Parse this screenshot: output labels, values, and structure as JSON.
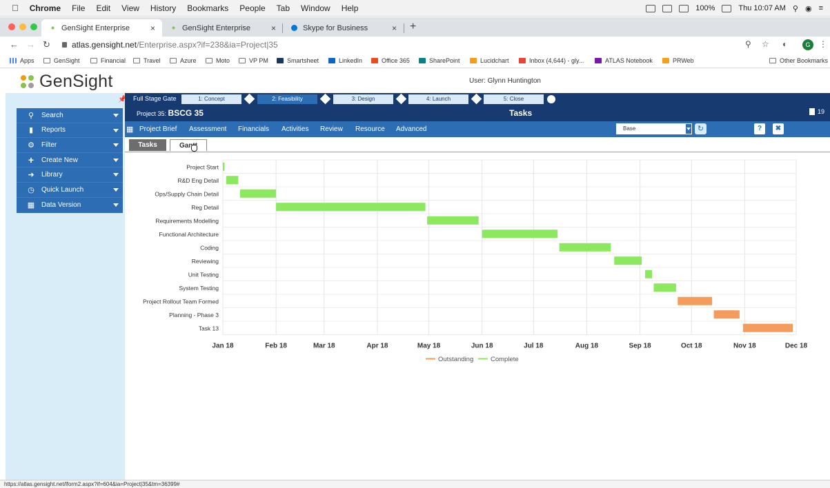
{
  "macos_menu": {
    "apple": "",
    "items": [
      "Chrome",
      "File",
      "Edit",
      "View",
      "History",
      "Bookmarks",
      "People",
      "Tab",
      "Window",
      "Help"
    ],
    "battery": "100%",
    "clock": "Thu 10:07 AM"
  },
  "browser": {
    "tabs": [
      {
        "title": "GenSight Enterprise",
        "active": true
      },
      {
        "title": "GenSight Enterprise",
        "active": false
      },
      {
        "title": "Skype for Business",
        "active": false
      }
    ],
    "new_tab": "+",
    "url_host": "atlas.gensight.net",
    "url_path": "/Enterprise.aspx?if=238&ia=Project|35",
    "profile_initial": "G",
    "bookmarks": [
      "Apps",
      "GenSight",
      "Financial",
      "Travel",
      "Azure",
      "Moto",
      "VP PM",
      "Smartsheet",
      "LinkedIn",
      "Office 365",
      "SharePoint",
      "Lucidchart",
      "Inbox (4,644) - gly...",
      "ATLAS Notebook",
      "PRWeb",
      "Other Bookmarks"
    ]
  },
  "app": {
    "logo_text": "GenSight",
    "user_label": "User: Glynn Huntington",
    "colors": {
      "sidebar_bg": "#d9edf9",
      "menu_bg": "#2d6db3",
      "stagebar_bg": "#173a70",
      "navbar_bg": "#2d6db3",
      "complete": "#8ce85e",
      "outstanding": "#f39c5b"
    }
  },
  "sidebar": {
    "items": [
      {
        "label": "Search",
        "icon": "search-icon"
      },
      {
        "label": "Reports",
        "icon": "document-icon"
      },
      {
        "label": "Filter",
        "icon": "gear-icon"
      },
      {
        "label": "Create New",
        "icon": "plus-icon"
      },
      {
        "label": "Library",
        "icon": "arrow-right-icon"
      },
      {
        "label": "Quick Launch",
        "icon": "clock-icon"
      },
      {
        "label": "Data Version",
        "icon": "calendar-icon"
      }
    ]
  },
  "stage_gate": {
    "title": "Full Stage Gate",
    "stages": [
      "1: Concept",
      "2: Feasibility",
      "3: Design",
      "4: Launch",
      "5: Close"
    ],
    "active_stage": 1,
    "project_prefix": "Project 35:",
    "project_name": "BSCG 35",
    "page_title": "Tasks",
    "doc_count": "19"
  },
  "nav": {
    "items": [
      "Project Brief",
      "Assessment",
      "Financials",
      "Activities",
      "Review",
      "Resource",
      "Advanced"
    ],
    "baseline_select": "Base",
    "help": "?"
  },
  "subtabs": {
    "tasks": "Tasks",
    "gantt": "Gantt"
  },
  "chart_data": {
    "type": "gantt",
    "x_ticks": [
      "Jan 18",
      "Feb 18",
      "Mar 18",
      "Apr 18",
      "May 18",
      "Jun 18",
      "Jul 18",
      "Aug 18",
      "Sep 18",
      "Oct 18",
      "Nov 18",
      "Dec 18"
    ],
    "xlim": [
      "2018-01-01",
      "2018-12-01"
    ],
    "grid": true,
    "legend": [
      "Outstanding",
      "Complete"
    ],
    "legend_position": "bottom",
    "tasks": [
      {
        "name": "Project Start",
        "start": "2018-01-01",
        "end": "2018-01-02",
        "status": "Complete"
      },
      {
        "name": "R&D Eng Detail",
        "start": "2018-01-03",
        "end": "2018-01-10",
        "status": "Complete"
      },
      {
        "name": "Ops/Supply Chain Detail",
        "start": "2018-01-11",
        "end": "2018-02-01",
        "status": "Complete"
      },
      {
        "name": "Reg Detail",
        "start": "2018-02-01",
        "end": "2018-04-29",
        "status": "Complete"
      },
      {
        "name": "Requirements Modelling",
        "start": "2018-04-30",
        "end": "2018-05-30",
        "status": "Complete"
      },
      {
        "name": "Functional Architecture",
        "start": "2018-06-01",
        "end": "2018-07-15",
        "status": "Complete"
      },
      {
        "name": "Coding",
        "start": "2018-07-16",
        "end": "2018-08-15",
        "status": "Complete"
      },
      {
        "name": "Reviewing",
        "start": "2018-08-17",
        "end": "2018-09-02",
        "status": "Complete"
      },
      {
        "name": "Unit Testing",
        "start": "2018-09-04",
        "end": "2018-09-08",
        "status": "Complete"
      },
      {
        "name": "System Testing",
        "start": "2018-09-09",
        "end": "2018-09-22",
        "status": "Complete"
      },
      {
        "name": "Project Rollout Team Formed",
        "start": "2018-09-23",
        "end": "2018-10-13",
        "status": "Outstanding"
      },
      {
        "name": "Planning - Phase 3",
        "start": "2018-10-14",
        "end": "2018-10-29",
        "status": "Outstanding"
      },
      {
        "name": "Task 13",
        "start": "2018-10-31",
        "end": "2018-11-29",
        "status": "Outstanding"
      }
    ]
  },
  "status_bar": {
    "url": "https://atlas.gensight.net/lform2.aspx?if=604&ia=Project|35&tm=36399#"
  }
}
